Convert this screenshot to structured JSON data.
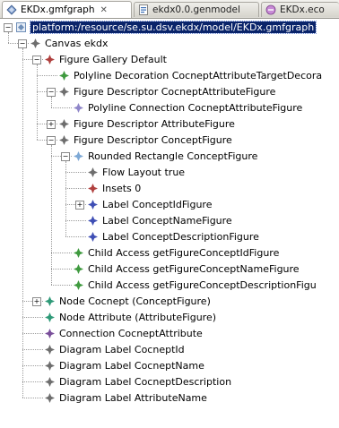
{
  "tabs": [
    {
      "label": "EKDx.gmfgraph",
      "active": true,
      "close": "✕"
    },
    {
      "label": "ekdx0.0.genmodel",
      "active": false
    },
    {
      "label": "EKDx.eco",
      "active": false
    }
  ],
  "toggles": {
    "collapsed": "+",
    "expanded": "−"
  },
  "tree": [
    {
      "label": "platform:/resource/se.su.dsv.ekdx/model/EKDx.gmfgraph",
      "depth": 0,
      "expander": "expanded",
      "icon": "resource",
      "selected": true
    },
    {
      "label": "Canvas ekdx",
      "depth": 1,
      "expander": "expanded",
      "icon": "gray"
    },
    {
      "label": "Figure Gallery Default",
      "depth": 2,
      "expander": "expanded",
      "icon": "red"
    },
    {
      "label": "Polyline Decoration CocneptAttributeTargetDecora",
      "depth": 3,
      "expander": "none",
      "icon": "green"
    },
    {
      "label": "Figure Descriptor CocneptAttributeFigure",
      "depth": 3,
      "expander": "expanded",
      "icon": "gray"
    },
    {
      "label": "Polyline Connection CocneptAttributeFigure",
      "depth": 4,
      "expander": "none",
      "icon": "lavender"
    },
    {
      "label": "Figure Descriptor AttributeFigure",
      "depth": 3,
      "expander": "collapsed",
      "icon": "gray"
    },
    {
      "label": "Figure Descriptor ConceptFigure",
      "depth": 3,
      "expander": "expanded",
      "icon": "gray"
    },
    {
      "label": "Rounded Rectangle ConceptFigure",
      "depth": 4,
      "expander": "expanded",
      "icon": "lightblue"
    },
    {
      "label": "Flow Layout true",
      "depth": 5,
      "expander": "none",
      "icon": "gray"
    },
    {
      "label": "Insets 0",
      "depth": 5,
      "expander": "none",
      "icon": "red"
    },
    {
      "label": "Label ConceptIdFigure",
      "depth": 5,
      "expander": "collapsed",
      "icon": "blue"
    },
    {
      "label": "Label ConceptNameFigure",
      "depth": 5,
      "expander": "none",
      "icon": "blue"
    },
    {
      "label": "Label ConceptDescriptionFigure",
      "depth": 5,
      "expander": "none",
      "icon": "blue"
    },
    {
      "label": "Child Access getFigureConceptIdFigure",
      "depth": 4,
      "expander": "none",
      "icon": "green"
    },
    {
      "label": "Child Access getFigureConceptNameFigure",
      "depth": 4,
      "expander": "none",
      "icon": "green"
    },
    {
      "label": "Child Access getFigureConceptDescriptionFigu",
      "depth": 4,
      "expander": "none",
      "icon": "green"
    },
    {
      "label": "Node Cocnept (ConceptFigure)",
      "depth": 2,
      "expander": "collapsed",
      "icon": "teal"
    },
    {
      "label": "Node Attribute (AttributeFigure)",
      "depth": 2,
      "expander": "none",
      "icon": "teal"
    },
    {
      "label": "Connection CocneptAttribute",
      "depth": 2,
      "expander": "none",
      "icon": "purple"
    },
    {
      "label": "Diagram Label CocneptId",
      "depth": 2,
      "expander": "none",
      "icon": "gray"
    },
    {
      "label": "Diagram Label CocneptName",
      "depth": 2,
      "expander": "none",
      "icon": "gray"
    },
    {
      "label": "Diagram Label CocneptDescription",
      "depth": 2,
      "expander": "none",
      "icon": "gray"
    },
    {
      "label": "Diagram Label AttributeName",
      "depth": 2,
      "expander": "none",
      "icon": "gray"
    }
  ],
  "icon_colors": {
    "gray": "#6e6e6e",
    "red": "#b0403e",
    "green": "#3f9a3f",
    "lavender": "#8f86c9",
    "lightblue": "#7ea9d6",
    "blue": "#3f4fb5",
    "teal": "#2f9a78",
    "purple": "#7a4f9a",
    "resource": "#6f8fb8",
    "selection": "#0a246a"
  }
}
